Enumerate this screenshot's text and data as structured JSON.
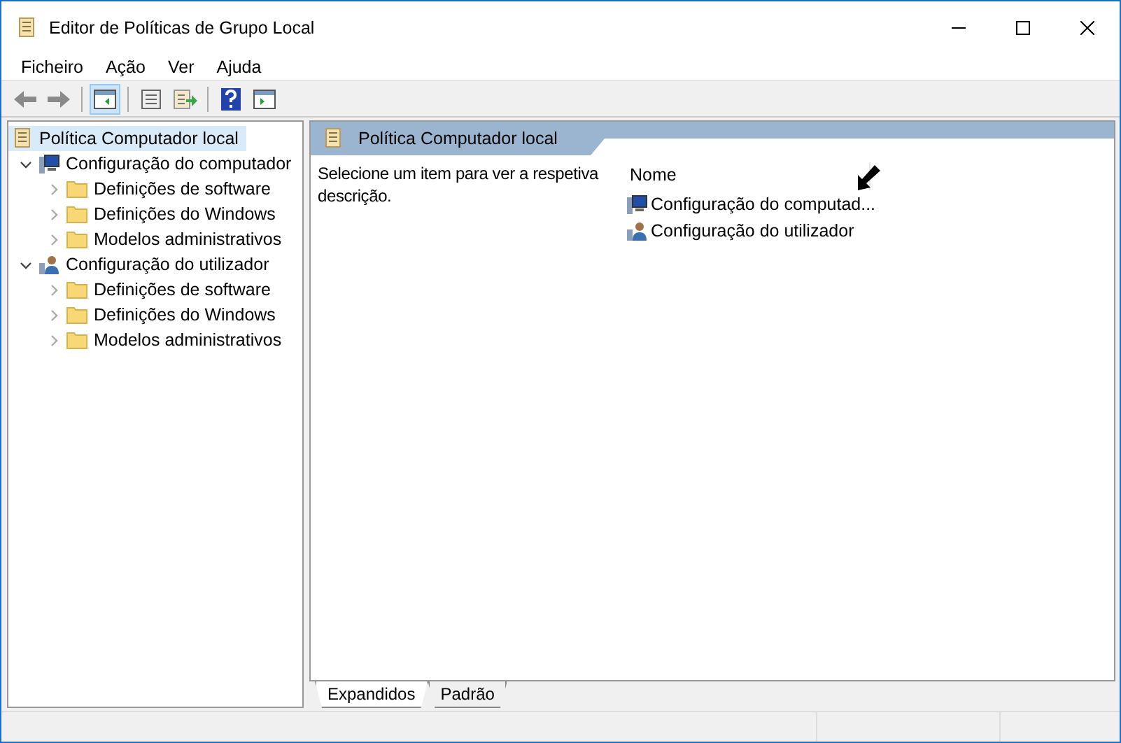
{
  "window": {
    "title": "Editor de Políticas de Grupo Local"
  },
  "menu": [
    "Ficheiro",
    "Ação",
    "Ver",
    "Ajuda"
  ],
  "toolbar": [
    {
      "kind": "back",
      "selected": false
    },
    {
      "kind": "forward",
      "selected": false
    },
    {
      "kind": "sep"
    },
    {
      "kind": "tree",
      "selected": true
    },
    {
      "kind": "sep"
    },
    {
      "kind": "props",
      "selected": false
    },
    {
      "kind": "export",
      "selected": false
    },
    {
      "kind": "sep"
    },
    {
      "kind": "help",
      "selected": false
    },
    {
      "kind": "view",
      "selected": false
    }
  ],
  "tree": {
    "label": "Política Computador local",
    "selected": true,
    "children": [
      {
        "label": "Configuração do computador",
        "kind": "computer",
        "expanded": true,
        "children": [
          {
            "label": "Definições de software",
            "expanded": false
          },
          {
            "label": "Definições do Windows",
            "expanded": false
          },
          {
            "label": "Modelos administrativos",
            "expanded": false
          }
        ]
      },
      {
        "label": "Configuração do utilizador",
        "kind": "user",
        "expanded": true,
        "children": [
          {
            "label": "Definições de software",
            "expanded": false
          },
          {
            "label": "Definições do Windows",
            "expanded": false
          },
          {
            "label": "Modelos administrativos",
            "expanded": false
          }
        ]
      }
    ]
  },
  "detail": {
    "header": "Política Computador local",
    "description": "Selecione um item para ver a respetiva descrição.",
    "column": "Nome",
    "items": [
      {
        "label": "Configuração do computad...",
        "kind": "computer"
      },
      {
        "label": "Configuração do utilizador",
        "kind": "user"
      }
    ]
  },
  "tabs": [
    {
      "label": "Expandidos",
      "selected": true
    },
    {
      "label": "Padrão",
      "selected": false
    }
  ]
}
